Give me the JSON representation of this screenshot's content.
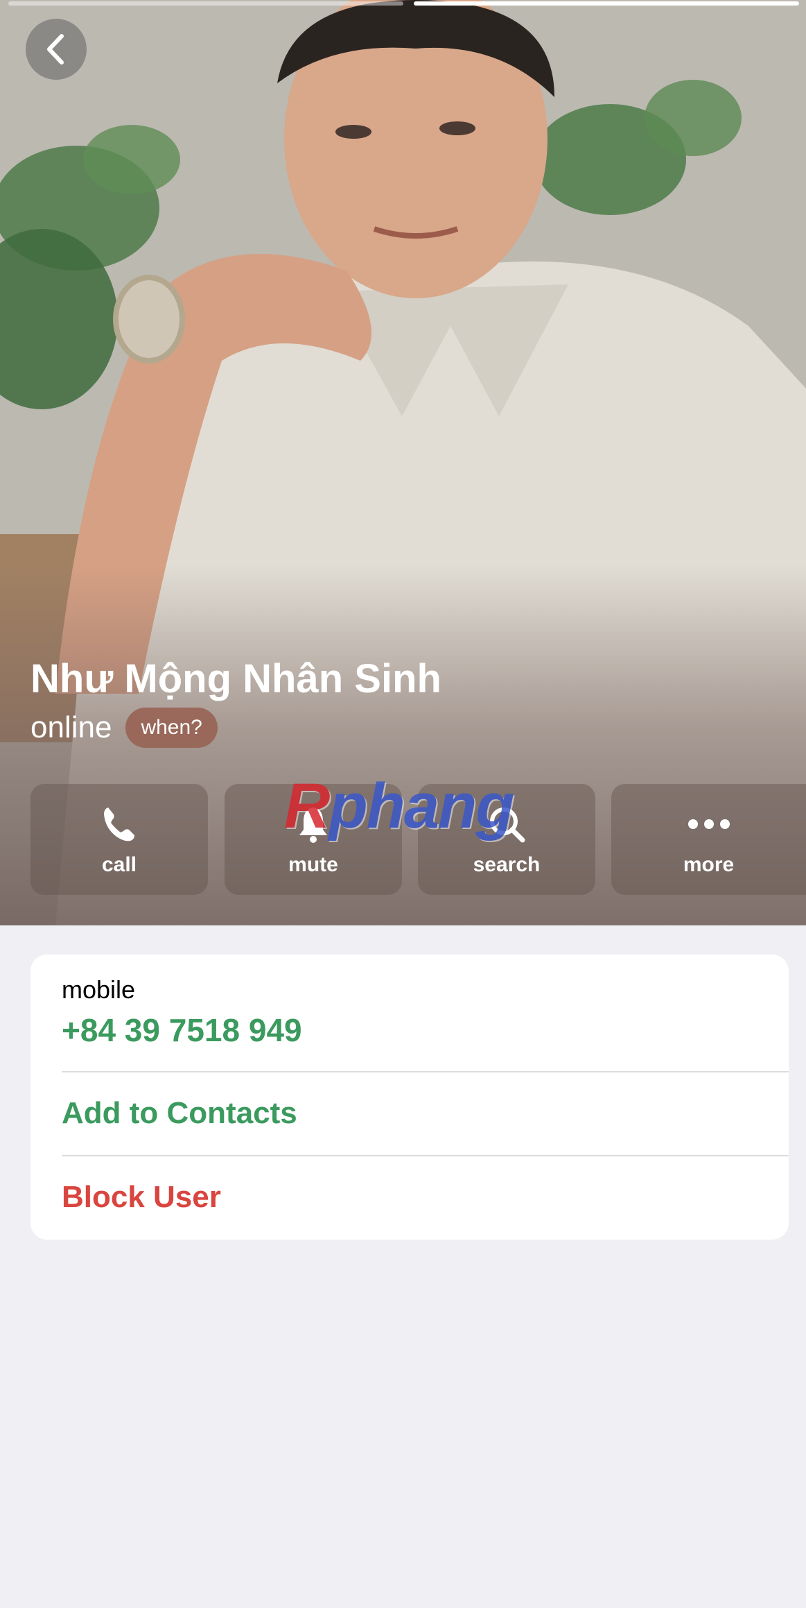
{
  "profile": {
    "name": "Như Mộng Nhân Sinh",
    "status": "online",
    "when_label": "when?"
  },
  "actions": {
    "call": "call",
    "mute": "mute",
    "search": "search",
    "more": "more"
  },
  "watermark": {
    "first": "R",
    "rest": "phang"
  },
  "info": {
    "phone_label": "mobile",
    "phone_number": "+84 39 7518 949",
    "add_contacts": "Add to Contacts",
    "block_user": "Block User"
  },
  "colors": {
    "accent_green": "#3b9a5e",
    "danger_red": "#d9453f",
    "background": "#efeff4"
  }
}
